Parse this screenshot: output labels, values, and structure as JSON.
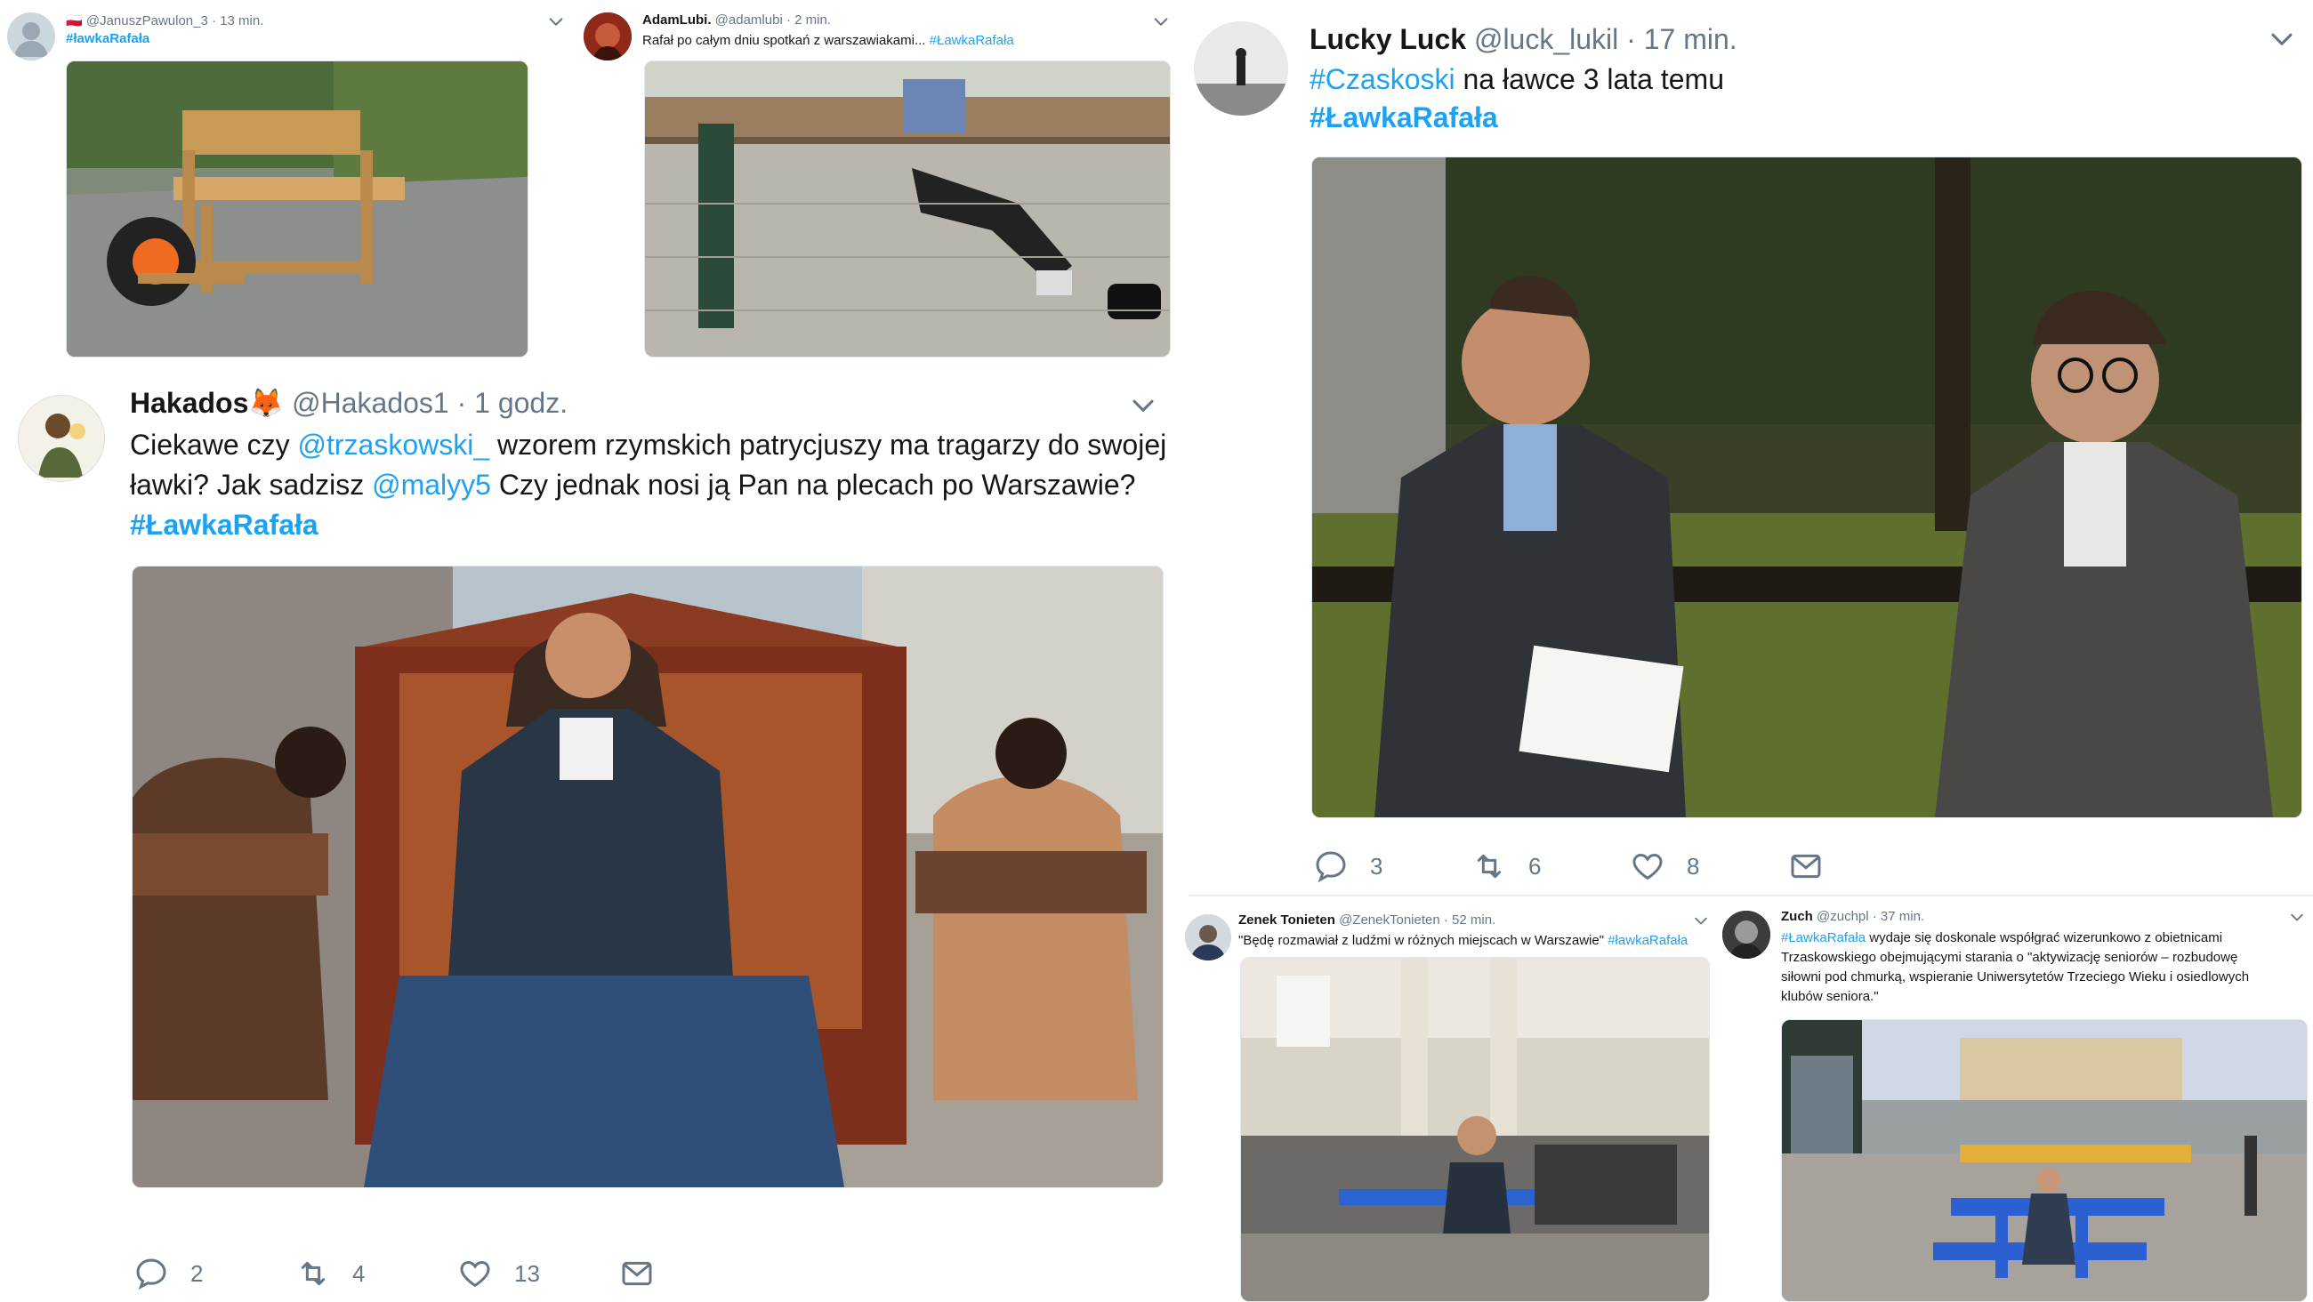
{
  "tweets": {
    "t1": {
      "flag": "🇵🇱",
      "handle": "@JanuszPawulon_3",
      "time": "· 13 min.",
      "hashtag": "#ławkaRafała"
    },
    "t2": {
      "name": "AdamLubi.",
      "handle": "@adamlubi · 2 min.",
      "text": "Rafał po całym dniu spotkań z warszawiakami... ",
      "hashtag": "#ŁawkaRafała"
    },
    "t3": {
      "name": "Hakados",
      "emoji": "🦊",
      "handle": "@Hakados1",
      "time": "· 1 godz.",
      "text_1": "Ciekawe czy ",
      "mention_1": "@trzaskowski_",
      "text_2": " wzorem rzymskich patrycjuszy ma tragarzy do swojej ławki? Jak sadzisz ",
      "mention_2": "@malyy5",
      "text_3": " Czy jednak nosi ją Pan na plecach po Warszawie?",
      "hashtag": "#ŁawkaRafała",
      "replies": "2",
      "retweets": "4",
      "likes": "13"
    },
    "t4": {
      "name": "Lucky Luck",
      "handle": "@luck_lukil",
      "time": "· 17 min.",
      "hashtag_1": "#Czaskoski",
      "text": " na ławce 3 lata temu",
      "hashtag_2": "#ŁawkaRafała",
      "replies": "3",
      "retweets": "6",
      "likes": "8"
    },
    "t5": {
      "name": "Zenek Tonieten",
      "handle": "@ZenekTonieten · 52 min.",
      "text": "\"Będę rozmawiał z ludźmi w różnych miejscach w Warszawie\" ",
      "hashtag": "#ławkaRafała"
    },
    "t6": {
      "name": "Zuch",
      "handle": "@zuchpl · 37 min.",
      "hashtag": "#ŁawkaRafała",
      "text_1": " wydaje się doskonale współgrać wizerunkowo z obietnicami",
      "text_2": "Trzaskowskiego obejmującymi starania o \"aktywizację seniorów – rozbudowę",
      "text_3": "siłowni pod chmurką, wspieranie Uniwersytetów Trzeciego Wieku i osiedlowych",
      "text_4": "klubów seniora.\""
    }
  },
  "colors": {
    "accent": "#1da1f2",
    "muted": "#657786",
    "text": "#14171a",
    "divider": "#e6ecf0"
  },
  "icons": [
    "reply-icon",
    "retweet-icon",
    "like-icon",
    "message-icon",
    "chevron-down-icon"
  ]
}
